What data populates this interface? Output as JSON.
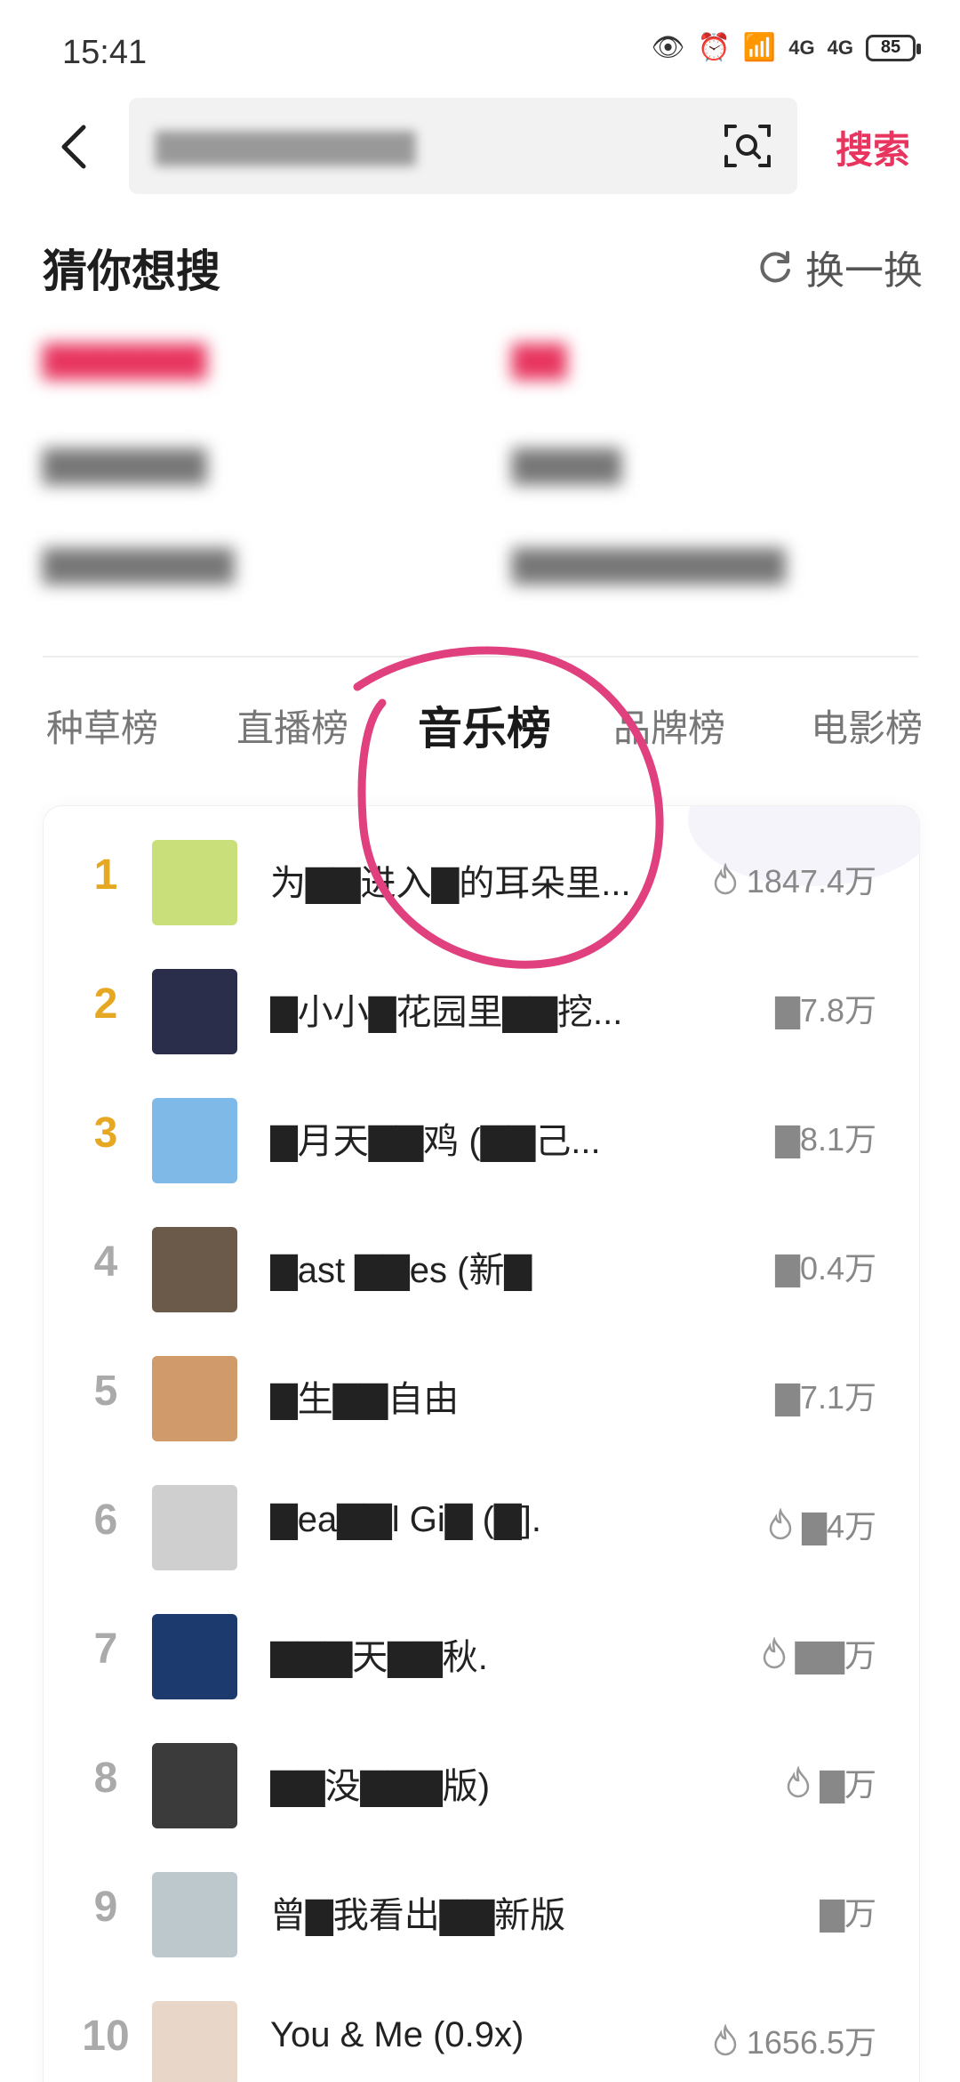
{
  "status_bar": {
    "time": "15:41",
    "battery": "85",
    "signal1": "4G",
    "signal2": "4G"
  },
  "search": {
    "placeholder": "",
    "button_label": "搜索"
  },
  "guess": {
    "title": "猜你想搜",
    "refresh_label": "换一换",
    "items": [
      {
        "text": "▇▇▇▇▇▇",
        "hot": true
      },
      {
        "text": "▇▇",
        "hot": true
      },
      {
        "text": "▇▇▇▇▇▇",
        "hot": false
      },
      {
        "text": "▇▇▇▇",
        "hot": false
      },
      {
        "text": "▇▇▇▇▇▇▇",
        "hot": false
      },
      {
        "text": "▇▇▇▇▇▇▇▇▇▇",
        "hot": false
      }
    ]
  },
  "tabs": [
    {
      "label": "种草榜",
      "active": false
    },
    {
      "label": "直播榜",
      "active": false
    },
    {
      "label": "音乐榜",
      "active": true
    },
    {
      "label": "品牌榜",
      "active": false
    },
    {
      "label": "电影榜",
      "active": false
    }
  ],
  "ranking": [
    {
      "rank": "1",
      "title": "为▇▇进入▇的耳朵里...",
      "heat": "1847.4万",
      "thumb_color": "#c9e07a"
    },
    {
      "rank": "2",
      "title": "▇小小▇花园里▇▇挖...",
      "heat": "▇7.8万",
      "thumb_color": "#2b2e4a"
    },
    {
      "rank": "3",
      "title": "▇月天▇▇鸡 (▇▇己...",
      "heat": "▇8.1万",
      "thumb_color": "#7fb9e8"
    },
    {
      "rank": "4",
      "title": "▇ast ▇▇es (新▇",
      "heat": "▇0.4万",
      "thumb_color": "#6b5a4a"
    },
    {
      "rank": "5",
      "title": "▇生▇▇自由",
      "heat": "▇7.1万",
      "thumb_color": "#d19a6b"
    },
    {
      "rank": "6",
      "title": "▇ea▇▇l Gi▇ (▇].",
      "heat": "▇4万",
      "thumb_color": "#cfcfcf"
    },
    {
      "rank": "7",
      "title": "▇▇▇天▇▇秋.",
      "heat": "▇▇万",
      "thumb_color": "#1d3a6e"
    },
    {
      "rank": "8",
      "title": "▇▇没▇▇▇版)",
      "heat": "▇万",
      "thumb_color": "#3b3b3b"
    },
    {
      "rank": "9",
      "title": "曾▇我看出▇▇新版",
      "heat": "▇万",
      "thumb_color": "#bcc8cc"
    },
    {
      "rank": "10",
      "title": "You & Me (0.9x)",
      "heat": "1656.5万",
      "thumb_color": "#e8d6c9"
    }
  ],
  "colors": {
    "accent": "#e8355f",
    "top_rank": "#e6a823",
    "annotation": "#e0407e"
  }
}
